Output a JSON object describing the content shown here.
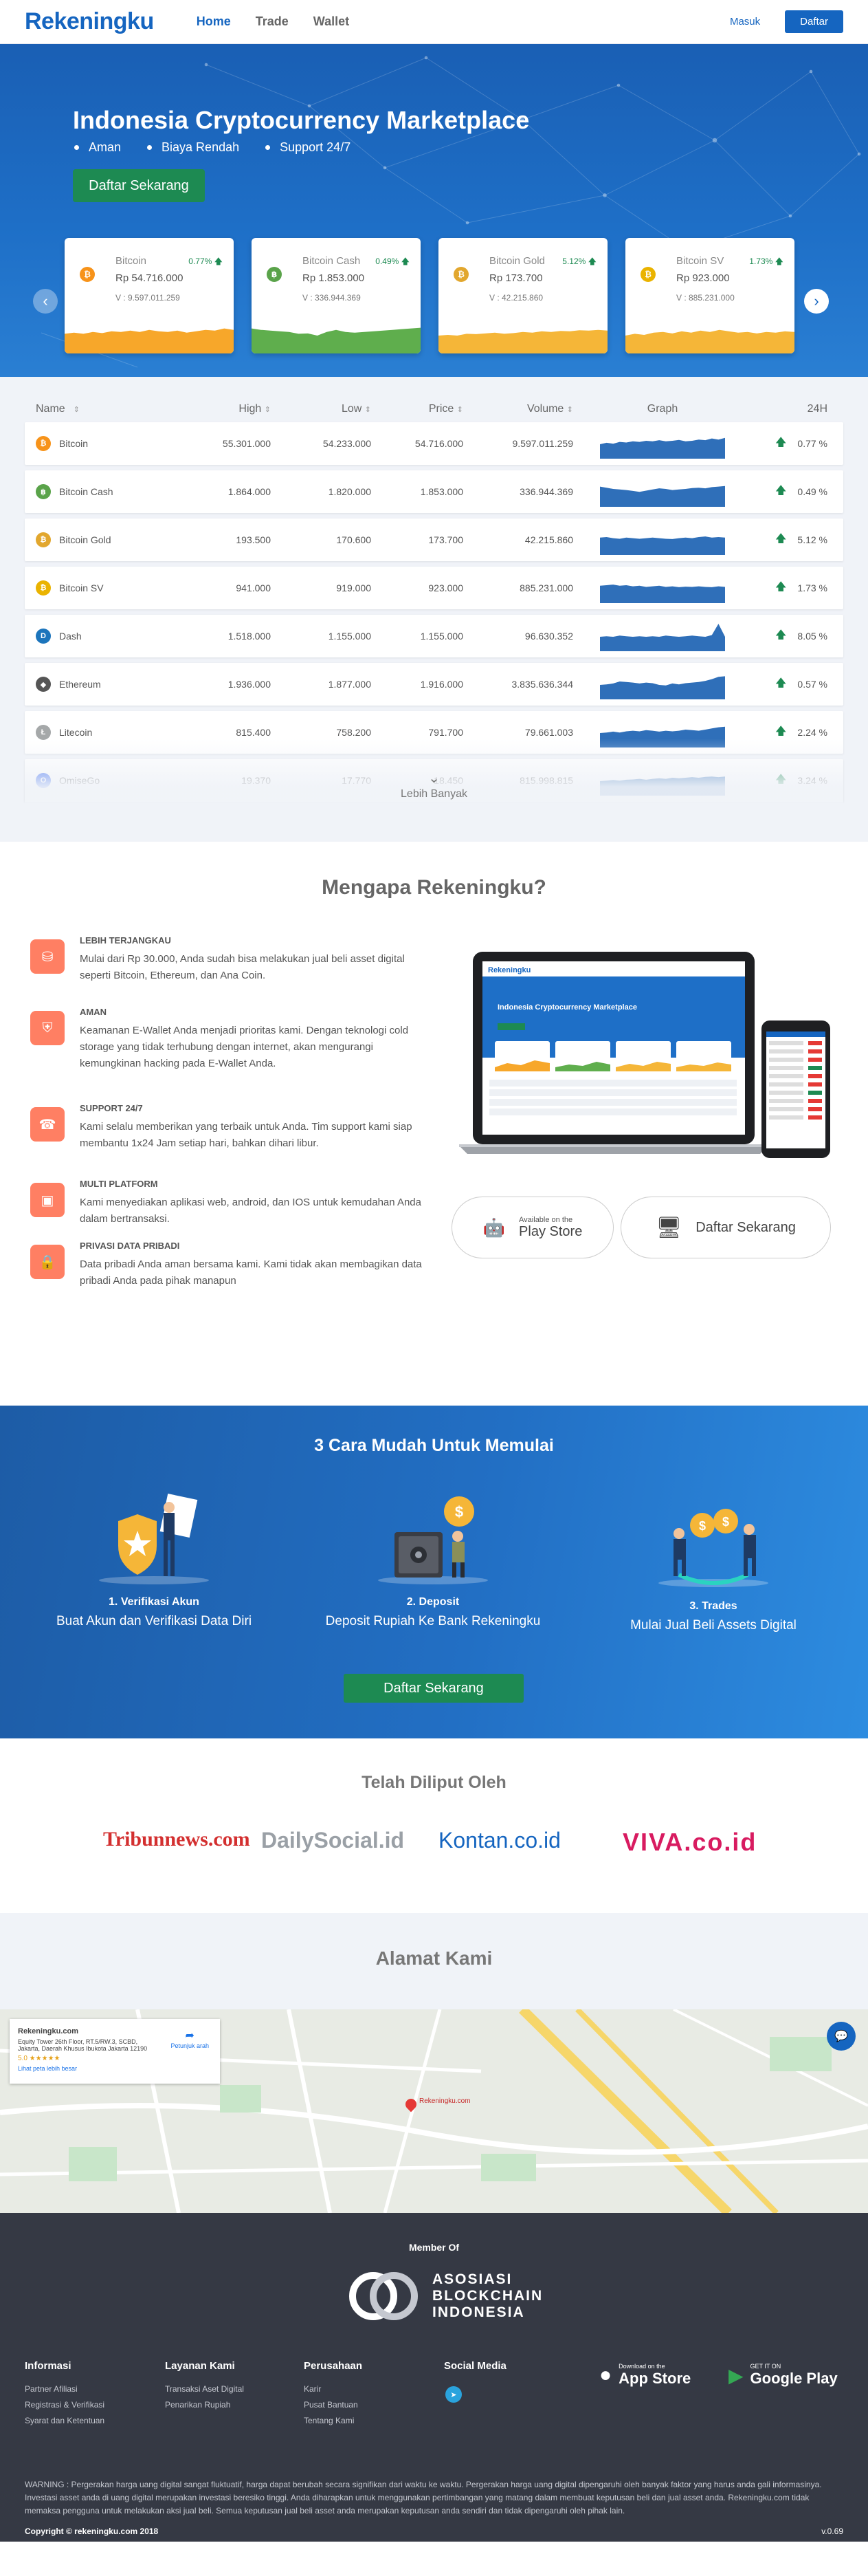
{
  "nav": {
    "logo": "Rekeningku",
    "links": [
      "Home",
      "Trade",
      "Wallet"
    ],
    "masuk": "Masuk",
    "daftar": "Daftar"
  },
  "hero": {
    "title": "Indonesia Cryptocurrency Marketplace",
    "features": [
      "Aman",
      "Biaya Rendah",
      "Support 24/7"
    ],
    "cta": "Daftar Sekarang",
    "cards": [
      {
        "name": "Bitcoin",
        "pct": "0.77%",
        "price": "Rp 54.716.000",
        "vol": "V : 9.597.011.259",
        "color": "#f7931a",
        "glyph": "₿",
        "chart": "#f7a72a",
        "trend": [
          0.55,
          0.58,
          0.55,
          0.6,
          0.57,
          0.62,
          0.6,
          0.64,
          0.6,
          0.66,
          0.62,
          0.6,
          0.64,
          0.58,
          0.62,
          0.66,
          0.64,
          0.7,
          0.66
        ]
      },
      {
        "name": "Bitcoin Cash",
        "pct": "0.49%",
        "price": "Rp 1.853.000",
        "vol": "V : 336.944.369",
        "color": "#5aa34a",
        "glyph": "฿",
        "chart": "#5fae4d",
        "trend": [
          0.7,
          0.66,
          0.64,
          0.62,
          0.6,
          0.55,
          0.56,
          0.5,
          0.6,
          0.66,
          0.6,
          0.58,
          0.6,
          0.62,
          0.64,
          0.66,
          0.68,
          0.7,
          0.72
        ]
      },
      {
        "name": "Bitcoin Gold",
        "pct": "5.12%",
        "price": "Rp 173.700",
        "vol": "V : 42.215.860",
        "color": "#e2a72e",
        "glyph": "₿",
        "chart": "#f5b638",
        "trend": [
          0.5,
          0.52,
          0.5,
          0.55,
          0.54,
          0.56,
          0.58,
          0.55,
          0.57,
          0.6,
          0.58,
          0.62,
          0.6,
          0.63,
          0.62,
          0.65,
          0.64,
          0.66,
          0.64
        ]
      },
      {
        "name": "Bitcoin SV",
        "pct": "1.73%",
        "price": "Rp 923.000",
        "vol": "V : 885.231.000",
        "color": "#eab300",
        "glyph": "₿",
        "chart": "#f5b638",
        "trend": [
          0.5,
          0.55,
          0.52,
          0.58,
          0.6,
          0.56,
          0.62,
          0.58,
          0.64,
          0.6,
          0.66,
          0.62,
          0.58,
          0.6,
          0.56,
          0.6,
          0.58,
          0.62,
          0.6
        ]
      }
    ]
  },
  "table": {
    "headers": {
      "name": "Name",
      "high": "High",
      "low": "Low",
      "price": "Price",
      "volume": "Volume",
      "graph": "Graph",
      "change": "24H"
    },
    "rows": [
      {
        "name": "Bitcoin",
        "high": "55.301.000",
        "low": "54.233.000",
        "price": "54.716.000",
        "volume": "9.597.011.259",
        "change": "0.77 %",
        "color": "#f7931a",
        "glyph": "₿",
        "trend": [
          0.5,
          0.55,
          0.52,
          0.58,
          0.56,
          0.6,
          0.58,
          0.62,
          0.6,
          0.64,
          0.6,
          0.62,
          0.65,
          0.6,
          0.62,
          0.66,
          0.64,
          0.7,
          0.66,
          0.72
        ]
      },
      {
        "name": "Bitcoin Cash",
        "high": "1.864.000",
        "low": "1.820.000",
        "price": "1.853.000",
        "volume": "336.944.369",
        "change": "0.49 %",
        "color": "#5aa34a",
        "glyph": "฿",
        "trend": [
          0.7,
          0.66,
          0.62,
          0.6,
          0.58,
          0.55,
          0.52,
          0.56,
          0.6,
          0.64,
          0.62,
          0.58,
          0.6,
          0.62,
          0.65,
          0.66,
          0.64,
          0.68,
          0.7,
          0.72
        ]
      },
      {
        "name": "Bitcoin Gold",
        "high": "193.500",
        "low": "170.600",
        "price": "173.700",
        "volume": "42.215.860",
        "change": "5.12 %",
        "color": "#e2a72e",
        "glyph": "₿",
        "trend": [
          0.6,
          0.62,
          0.58,
          0.56,
          0.6,
          0.58,
          0.56,
          0.58,
          0.6,
          0.58,
          0.56,
          0.55,
          0.58,
          0.6,
          0.58,
          0.62,
          0.64,
          0.6,
          0.62,
          0.6
        ]
      },
      {
        "name": "Bitcoin SV",
        "high": "941.000",
        "low": "919.000",
        "price": "923.000",
        "volume": "885.231.000",
        "change": "1.73 %",
        "color": "#eab300",
        "glyph": "₿",
        "trend": [
          0.6,
          0.62,
          0.64,
          0.6,
          0.62,
          0.58,
          0.6,
          0.56,
          0.58,
          0.6,
          0.56,
          0.58,
          0.55,
          0.57,
          0.56,
          0.58,
          0.56,
          0.55,
          0.58,
          0.56
        ]
      },
      {
        "name": "Dash",
        "high": "1.518.000",
        "low": "1.155.000",
        "price": "1.155.000",
        "volume": "96.630.352",
        "change": "8.05 %",
        "color": "#1c75bc",
        "glyph": "D",
        "trend": [
          0.5,
          0.52,
          0.5,
          0.54,
          0.52,
          0.5,
          0.52,
          0.5,
          0.52,
          0.5,
          0.54,
          0.52,
          0.5,
          0.52,
          0.54,
          0.52,
          0.5,
          0.56,
          0.95,
          0.5
        ]
      },
      {
        "name": "Ethereum",
        "high": "1.936.000",
        "low": "1.877.000",
        "price": "1.916.000",
        "volume": "3.835.636.344",
        "change": "0.57 %",
        "color": "#555555",
        "glyph": "◆",
        "trend": [
          0.5,
          0.52,
          0.55,
          0.62,
          0.6,
          0.58,
          0.55,
          0.58,
          0.56,
          0.5,
          0.48,
          0.55,
          0.52,
          0.56,
          0.58,
          0.6,
          0.64,
          0.7,
          0.78,
          0.8
        ]
      },
      {
        "name": "Litecoin",
        "high": "815.400",
        "low": "758.200",
        "price": "791.700",
        "volume": "79.661.003",
        "change": "2.24 %",
        "color": "#a5a8a9",
        "glyph": "Ł",
        "trend": [
          0.5,
          0.52,
          0.55,
          0.52,
          0.56,
          0.58,
          0.56,
          0.6,
          0.58,
          0.55,
          0.58,
          0.56,
          0.58,
          0.62,
          0.6,
          0.58,
          0.62,
          0.66,
          0.7,
          0.72
        ]
      },
      {
        "name": "OmiseGo",
        "high": "19.370",
        "low": "17.770",
        "price": "18.450",
        "volume": "815.998.815",
        "change": "3.24 %",
        "color": "#1a53f0",
        "glyph": "O",
        "trend": [
          0.5,
          0.52,
          0.54,
          0.52,
          0.55,
          0.56,
          0.58,
          0.55,
          0.58,
          0.6,
          0.58,
          0.62,
          0.6,
          0.62,
          0.64,
          0.62,
          0.65,
          0.66,
          0.64,
          0.66
        ]
      }
    ],
    "more": "Lebih Banyak"
  },
  "why": {
    "title": "Mengapa Rekeningku?",
    "reasons": [
      {
        "title": "LEBIH TERJANGKAU",
        "desc": "Mulai dari Rp 30.000, Anda sudah bisa melakukan jual beli asset digital seperti Bitcoin, Ethereum, dan Ana Coin.",
        "icon": "coin-icon"
      },
      {
        "title": "AMAN",
        "desc": "Keamanan E-Wallet Anda menjadi prioritas kami. Dengan teknologi cold storage yang tidak terhubung dengan internet, akan mengurangi kemungkinan hacking pada E-Wallet Anda.",
        "icon": "shield-icon"
      },
      {
        "title": "SUPPORT 24/7",
        "desc": "Kami selalu memberikan yang terbaik untuk Anda. Tim support kami siap membantu 1x24 Jam setiap hari, bahkan dihari libur.",
        "icon": "headset-icon"
      },
      {
        "title": "MULTI PLATFORM",
        "desc": "Kami menyediakan aplikasi web, android, dan IOS untuk kemudahan Anda dalam bertransaksi.",
        "icon": "devices-icon"
      },
      {
        "title": "PRIVASI DATA PRIBADI",
        "desc": "Data pribadi Anda aman bersama kami. Kami tidak akan membagikan data pribadi Anda pada pihak manapun",
        "icon": "lock-icon"
      }
    ],
    "playstore_small": "Available on the",
    "playstore_big": "Play Store",
    "daftar": "Daftar Sekarang",
    "mock_logo": "Rekeningku",
    "mock_title": "Indonesia Cryptocurrency Marketplace"
  },
  "steps": {
    "title": "3 Cara Mudah Untuk Memulai",
    "items": [
      {
        "title": "1. Verifikasi Akun",
        "desc": "Buat Akun dan Verifikasi Data Diri"
      },
      {
        "title": "2. Deposit",
        "desc": "Deposit Rupiah Ke Bank Rekeningku"
      },
      {
        "title": "3. Trades",
        "desc": "Mulai Jual Beli Assets Digital"
      }
    ],
    "cta": "Daftar Sekarang"
  },
  "press": {
    "title": "Telah Diliput Oleh",
    "logos": [
      "Tribunnews.com",
      "DailySocial.id",
      "Kontan.co.id",
      "VIVA.co.id"
    ]
  },
  "address": {
    "title": "Alamat Kami",
    "map_name": "Rekeningku.com",
    "map_addr": "Equity Tower 26th Floor, RT.5/RW.3, SCBD, Jakarta, Daerah Khusus Ibukota Jakarta 12190",
    "map_rating": "5.0 ★★★★★",
    "map_link": "Lihat peta lebih besar",
    "map_dir": "Petunjuk arah",
    "pin_label": "Rekeningku.com"
  },
  "footer": {
    "member": "Member Of",
    "abi": [
      "ASOSIASI",
      "BLOCKCHAIN",
      "INDONESIA"
    ],
    "columns": [
      {
        "title": "Informasi",
        "items": [
          "Partner Afiliasi",
          "Registrasi & Verifikasi",
          "Syarat dan Ketentuan"
        ]
      },
      {
        "title": "Layanan Kami",
        "items": [
          "Transaksi Aset Digital",
          "Penarikan Rupiah"
        ]
      },
      {
        "title": "Perusahaan",
        "items": [
          "Karir",
          "Pusat Bantuan",
          "Tentang Kami"
        ]
      },
      {
        "title": "Social Media",
        "items": []
      }
    ],
    "appstore_small": "Download on the",
    "appstore_big": "App Store",
    "gplay_small": "GET IT ON",
    "gplay_big": "Google Play",
    "warning": "WARNING : Pergerakan harga uang digital sangat fluktuatif, harga dapat berubah secara signifikan dari waktu ke waktu. Pergerakan harga uang digital dipengaruhi oleh banyak faktor yang harus anda gali informasinya. Investasi asset anda di uang digital merupakan investasi beresiko tinggi. Anda diharapkan untuk menggunakan pertimbangan yang matang dalam membuat keputusan beli dan jual asset anda. Rekeningku.com tidak memaksa pengguna untuk melakukan aksi jual beli. Semua keputusan jual beli asset anda merupakan keputusan anda sendiri dan tidak dipengaruhi oleh pihak lain.",
    "copyright": "Copyright © rekeningku.com 2018",
    "version": "v.0.69"
  }
}
